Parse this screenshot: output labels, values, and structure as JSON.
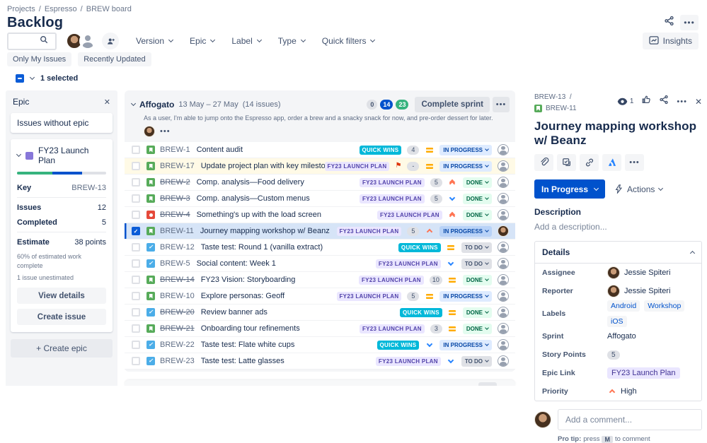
{
  "breadcrumb": {
    "items": [
      "Projects",
      "Espresso",
      "BREW board"
    ]
  },
  "page": {
    "title": "Backlog"
  },
  "toolbar": {
    "filters": [
      "Version",
      "Epic",
      "Label",
      "Type",
      "Quick filters"
    ],
    "quick_filters": [
      "Only My Issues",
      "Recently Updated"
    ],
    "insights_label": "Insights",
    "more_label": "•••"
  },
  "bulkbar": {
    "selected_text": "1 selected"
  },
  "epic_panel": {
    "title": "Epic",
    "no_epic_label": "Issues without epic",
    "epic": {
      "name": "FY23 Launch Plan",
      "progress": {
        "done_pct": 40,
        "inprogress_pct": 33
      },
      "key_label": "Key",
      "key_value": "BREW-13",
      "issues_label": "Issues",
      "issues_value": "12",
      "completed_label": "Completed",
      "completed_value": "5",
      "estimate_label": "Estimate",
      "estimate_value": "38 points",
      "note1": "60% of estimated work complete",
      "note2": "1 issue unestimated",
      "view_details_label": "View details",
      "create_issue_label": "Create issue"
    },
    "create_epic_label": "+ Create epic"
  },
  "sprint": {
    "name": "Affogato",
    "dates": "13 May – 27 May",
    "count": "(14 issues)",
    "goal": "As a user, I'm able to jump onto the Espresso app, order a brew and a snacky snack for now, and pre-order dessert for later.",
    "badges": [
      {
        "value": "0",
        "variant": "gray"
      },
      {
        "value": "14",
        "variant": "blue"
      },
      {
        "value": "23",
        "variant": "green"
      }
    ],
    "complete_label": "Complete sprint",
    "more_label": "•••",
    "issues": [
      {
        "key": "BREW-1",
        "title": "Content audit",
        "type": "story",
        "epic": "QUICK WINS",
        "epic_variant": "teal",
        "estimate": "4",
        "priority": "medium",
        "status": "IN PROGRESS",
        "status_variant": "inprogress",
        "done": false,
        "selected": false,
        "highlight": false,
        "flagged": false,
        "avatar": "default"
      },
      {
        "key": "BREW-17",
        "title": "Update project plan with key milestones",
        "type": "story",
        "epic": "FY23 LAUNCH PLAN",
        "epic_variant": "purple",
        "estimate": "-",
        "priority": "medium",
        "status": "IN PROGRESS",
        "status_variant": "inprogress",
        "done": false,
        "selected": false,
        "highlight": true,
        "flagged": true,
        "avatar": "default"
      },
      {
        "key": "BREW-2",
        "title": "Comp. analysis—Food delivery",
        "type": "story",
        "epic": "FY23 LAUNCH PLAN",
        "epic_variant": "purple",
        "estimate": "5",
        "priority": "highest",
        "status": "DONE",
        "status_variant": "done",
        "done": true,
        "selected": false,
        "highlight": false,
        "flagged": false,
        "avatar": "default"
      },
      {
        "key": "BREW-3",
        "title": "Comp. analysis—Custom menus",
        "type": "story",
        "epic": "FY23 LAUNCH PLAN",
        "epic_variant": "purple",
        "estimate": "5",
        "priority": "low",
        "status": "DONE",
        "status_variant": "done",
        "done": true,
        "selected": false,
        "highlight": false,
        "flagged": false,
        "avatar": "default"
      },
      {
        "key": "BREW-4",
        "title": "Something's up with the load screen",
        "type": "bug",
        "epic": "FY23 LAUNCH PLAN",
        "epic_variant": "purple",
        "estimate": "",
        "priority": "highest",
        "status": "DONE",
        "status_variant": "done",
        "done": true,
        "selected": false,
        "highlight": false,
        "flagged": false,
        "avatar": "default"
      },
      {
        "key": "BREW-11",
        "title": "Journey mapping workshop w/ Beanz",
        "type": "story",
        "epic": "FY23 LAUNCH PLAN",
        "epic_variant": "purple",
        "estimate": "5",
        "priority": "high",
        "status": "IN PROGRESS",
        "status_variant": "inprogress",
        "done": false,
        "selected": true,
        "highlight": false,
        "flagged": false,
        "avatar": "jessie"
      },
      {
        "key": "BREW-12",
        "title": "Taste test: Round 1 (vanilla extract)",
        "type": "task",
        "epic": "QUICK WINS",
        "epic_variant": "teal",
        "estimate": "",
        "priority": "medium",
        "status": "TO DO",
        "status_variant": "todo",
        "done": false,
        "selected": false,
        "highlight": false,
        "flagged": false,
        "avatar": "default"
      },
      {
        "key": "BREW-5",
        "title": "Social content: Week 1",
        "type": "task",
        "epic": "FY23 LAUNCH PLAN",
        "epic_variant": "purple",
        "estimate": "",
        "priority": "low",
        "status": "TO DO",
        "status_variant": "todo",
        "done": false,
        "selected": false,
        "highlight": false,
        "flagged": false,
        "avatar": "default"
      },
      {
        "key": "BREW-14",
        "title": "FY23 Vision: Storyboarding",
        "type": "story",
        "epic": "FY23 LAUNCH PLAN",
        "epic_variant": "purple",
        "estimate": "10",
        "priority": "medium",
        "status": "DONE",
        "status_variant": "done",
        "done": true,
        "selected": false,
        "highlight": false,
        "flagged": false,
        "avatar": "default"
      },
      {
        "key": "BREW-10",
        "title": "Explore personas: Geoff",
        "type": "story",
        "epic": "FY23 LAUNCH PLAN",
        "epic_variant": "purple",
        "estimate": "5",
        "priority": "medium",
        "status": "IN PROGRESS",
        "status_variant": "inprogress",
        "done": false,
        "selected": false,
        "highlight": false,
        "flagged": false,
        "avatar": "default"
      },
      {
        "key": "BREW-20",
        "title": "Review banner ads",
        "type": "task",
        "epic": "QUICK WINS",
        "epic_variant": "teal",
        "estimate": "",
        "priority": "medium",
        "status": "DONE",
        "status_variant": "done",
        "done": true,
        "selected": false,
        "highlight": false,
        "flagged": false,
        "avatar": "default"
      },
      {
        "key": "BREW-21",
        "title": "Onboarding tour refinements",
        "type": "story",
        "epic": "FY23 LAUNCH PLAN",
        "epic_variant": "purple",
        "estimate": "3",
        "priority": "medium",
        "status": "DONE",
        "status_variant": "done",
        "done": true,
        "selected": false,
        "highlight": false,
        "flagged": false,
        "avatar": "default"
      },
      {
        "key": "BREW-22",
        "title": "Taste test: Flate white cups",
        "type": "task",
        "epic": "QUICK WINS",
        "epic_variant": "teal",
        "estimate": "",
        "priority": "low",
        "status": "IN PROGRESS",
        "status_variant": "inprogress",
        "done": false,
        "selected": false,
        "highlight": false,
        "flagged": false,
        "avatar": "default"
      },
      {
        "key": "BREW-23",
        "title": "Taste test: Latte glasses",
        "type": "task",
        "epic": "FY23 LAUNCH PLAN",
        "epic_variant": "purple",
        "estimate": "",
        "priority": "low",
        "status": "TO DO",
        "status_variant": "todo",
        "done": false,
        "selected": false,
        "highlight": false,
        "flagged": false,
        "avatar": "default"
      }
    ]
  },
  "detail": {
    "parent_key": "BREW-13",
    "key": "BREW-11",
    "watchers": "1",
    "title": "Journey mapping workshop w/ Beanz",
    "status_label": "In Progress",
    "actions_label": "Actions",
    "description_label": "Description",
    "description_placeholder": "Add a description...",
    "details_label": "Details",
    "fields": {
      "assignee_label": "Assignee",
      "assignee": "Jessie Spiteri",
      "reporter_label": "Reporter",
      "reporter": "Jessie Spiteri",
      "labels_label": "Labels",
      "labels": [
        "Android",
        "Workshop",
        "iOS"
      ],
      "sprint_label": "Sprint",
      "sprint": "Affogato",
      "points_label": "Story Points",
      "points": "5",
      "epic_label": "Epic Link",
      "epic": "FY23 Launch Plan",
      "priority_label": "Priority",
      "priority": "High"
    },
    "comment_placeholder": "Add a comment...",
    "protip_bold": "Pro tip:",
    "protip_mid": "press",
    "protip_key": "M",
    "protip_suffix": "to comment"
  },
  "colors": {
    "accent": "#0052CC",
    "done_green": "#36B37E",
    "epic_purple": "#8777D9",
    "quickwins_teal": "#00B8D9",
    "selected_row": "#D6E4F7",
    "highlight_row": "#FFFAE6",
    "danger_flag": "#DE350B",
    "medium_priority": "#FFAB00"
  }
}
